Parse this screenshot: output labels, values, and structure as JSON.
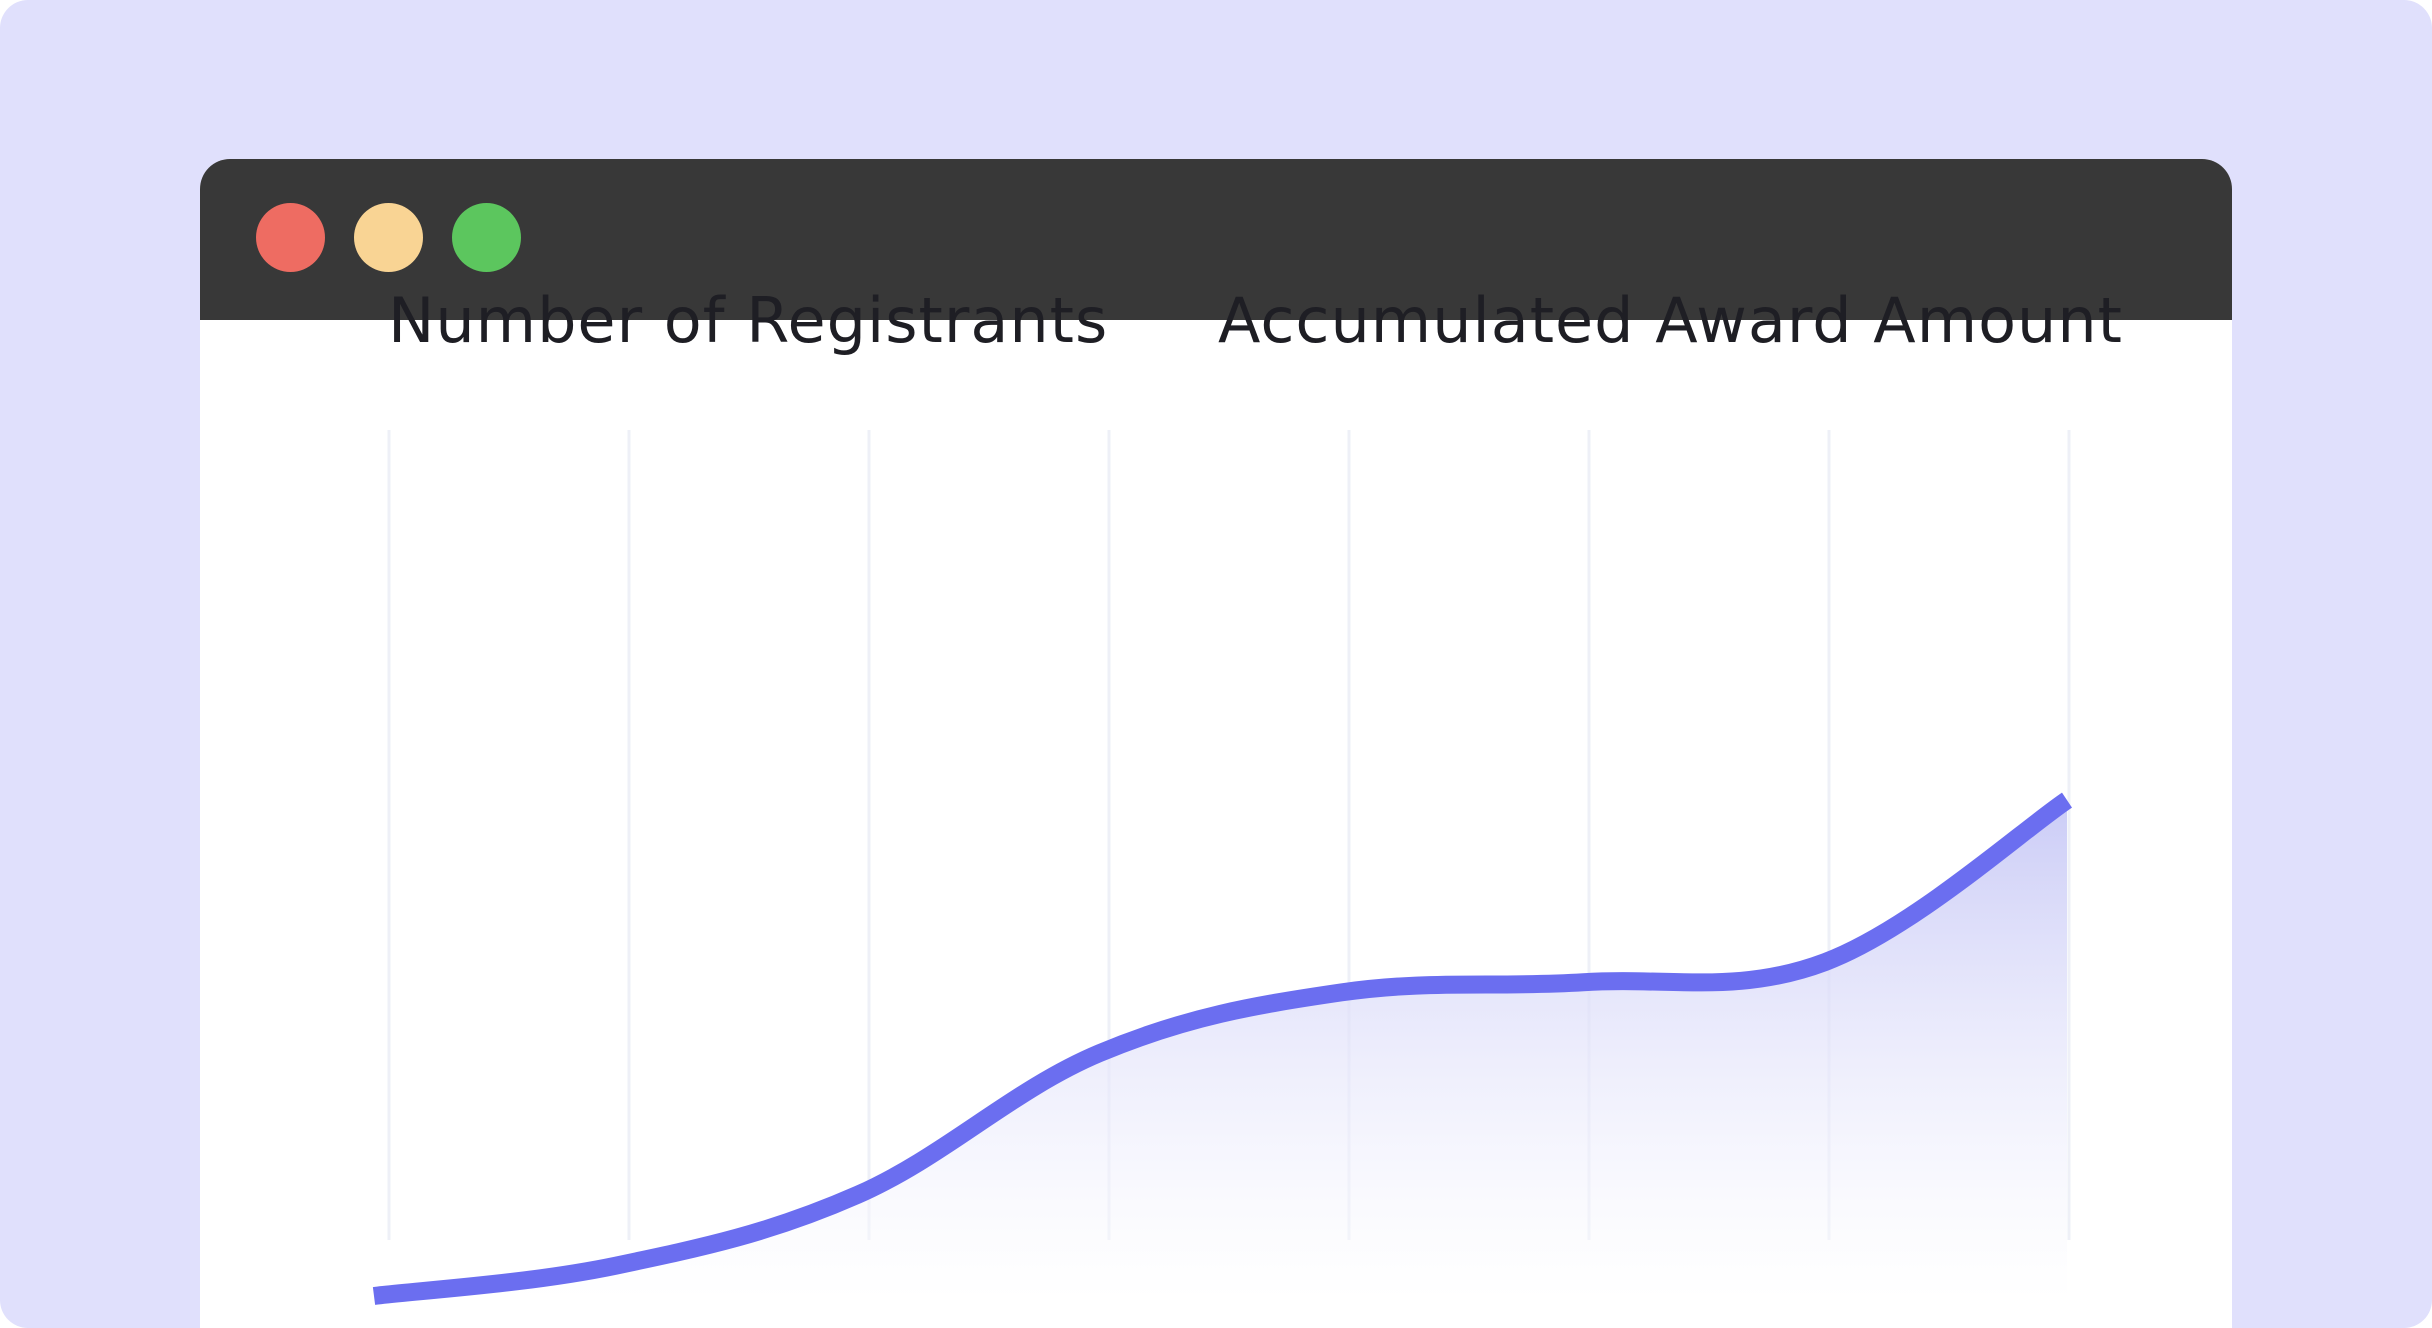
{
  "window": {
    "controls": [
      {
        "name": "close",
        "color": "#ee6c62"
      },
      {
        "name": "minimize",
        "color": "#f9d494"
      },
      {
        "name": "maximize",
        "color": "#5cc65e"
      }
    ],
    "titlebar_color": "#383838"
  },
  "background_color": "#e0e0fc",
  "headings": {
    "left": "Number of Registrants",
    "right": "Accumulated Award Amount"
  },
  "chart_data": {
    "type": "area",
    "title": "",
    "xlabel": "",
    "ylabel": "",
    "grid": "vertical",
    "x": [
      0,
      1,
      2,
      3,
      4,
      5,
      6,
      7
    ],
    "series": [
      {
        "values": [
          0,
          3,
          10,
          24,
          30,
          31,
          33,
          49
        ],
        "color": "#6b6ef0"
      }
    ],
    "ylim": [
      0,
      50
    ]
  }
}
